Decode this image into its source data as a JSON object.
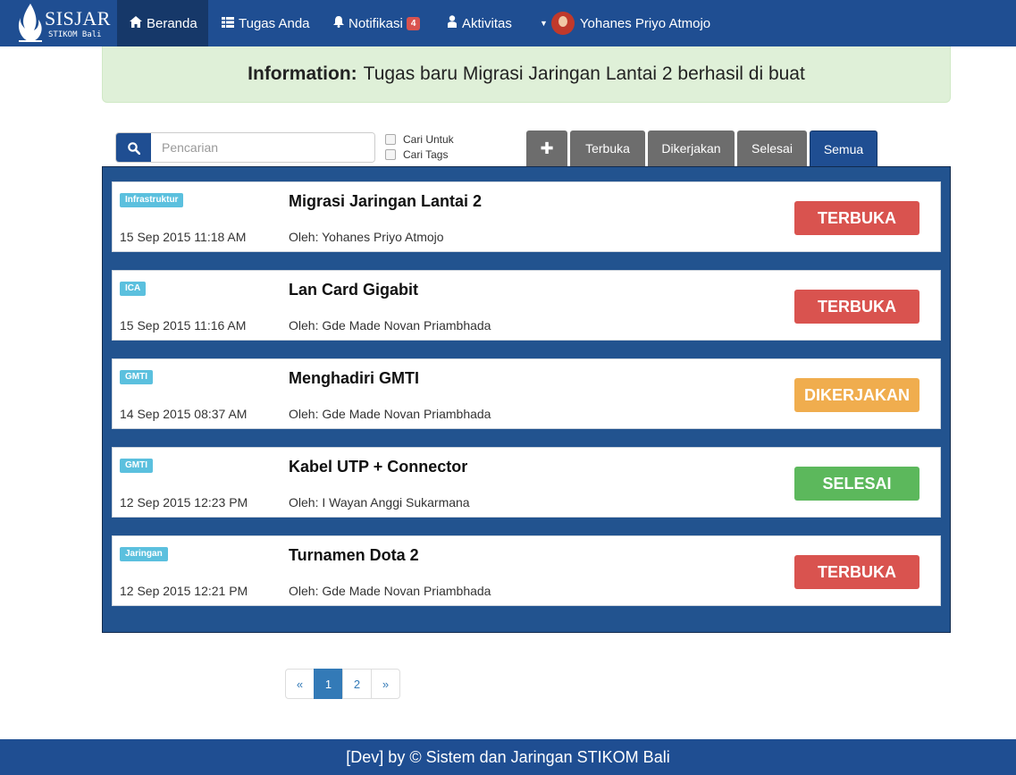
{
  "nav": {
    "brand": "SISJAR",
    "brand_sub": "STIKOM Bali",
    "items": [
      {
        "label": "Beranda",
        "icon": "home-icon"
      },
      {
        "label": "Tugas Anda",
        "icon": "table-icon"
      },
      {
        "label": "Notifikasi",
        "icon": "bell-icon",
        "badge": "4"
      },
      {
        "label": "Aktivitas",
        "icon": "user-icon"
      }
    ],
    "user_name": "Yohanes Priyo Atmojo"
  },
  "info": {
    "label": "Information:",
    "message": "Tugas baru Migrasi Jaringan Lantai 2 berhasil di buat"
  },
  "search": {
    "placeholder": "Pencarian",
    "value": "",
    "opt_untuk": "Cari Untuk",
    "opt_tags": "Cari Tags"
  },
  "tabs": {
    "add": "✚",
    "terbuka": "Terbuka",
    "dikerjakan": "Dikerjakan",
    "selesai": "Selesai",
    "semua": "Semua"
  },
  "tasks": [
    {
      "tag": "Infrastruktur",
      "date": "15 Sep 2015 11:18 AM",
      "title": "Migrasi Jaringan Lantai 2",
      "by": "Oleh: Yohanes Priyo Atmojo",
      "status": "TERBUKA",
      "status_color": "#d9534f"
    },
    {
      "tag": "ICA",
      "date": "15 Sep 2015 11:16 AM",
      "title": "Lan Card Gigabit",
      "by": "Oleh: Gde Made Novan Priambhada",
      "status": "TERBUKA",
      "status_color": "#d9534f"
    },
    {
      "tag": "GMTI",
      "date": "14 Sep 2015 08:37 AM",
      "title": "Menghadiri GMTI",
      "by": "Oleh: Gde Made Novan Priambhada",
      "status": "DIKERJAKAN",
      "status_color": "#f0ad4e"
    },
    {
      "tag": "GMTI",
      "date": "12 Sep 2015 12:23 PM",
      "title": "Kabel UTP + Connector",
      "by": "Oleh: I Wayan Anggi Sukarmana",
      "status": "SELESAI",
      "status_color": "#5cb85c"
    },
    {
      "tag": "Jaringan",
      "date": "12 Sep 2015 12:21 PM",
      "title": "Turnamen Dota 2",
      "by": "Oleh: Gde Made Novan Priambhada",
      "status": "TERBUKA",
      "status_color": "#d9534f"
    }
  ],
  "pagination": {
    "prev": "«",
    "p1": "1",
    "p2": "2",
    "next": "»"
  },
  "footer": "[Dev] by © Sistem dan Jaringan STIKOM Bali"
}
